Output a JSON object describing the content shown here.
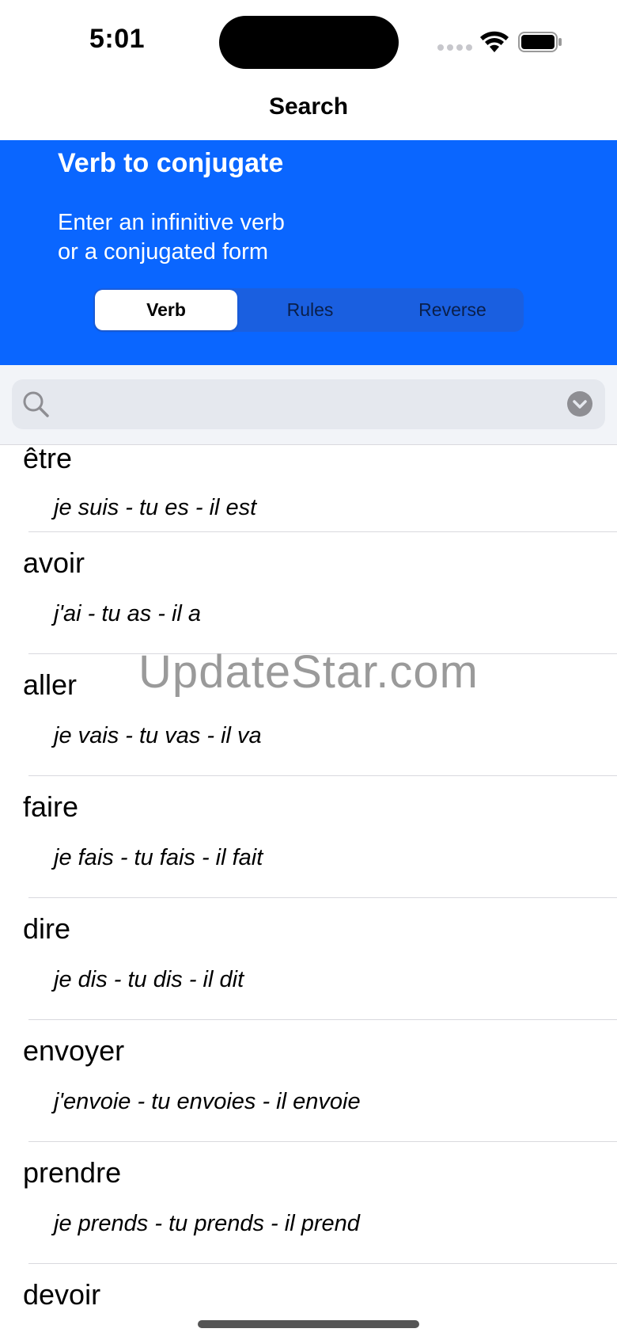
{
  "status_bar": {
    "time": "5:01"
  },
  "nav": {
    "title": "Search"
  },
  "header": {
    "title": "Verb to conjugate",
    "subtitle": "Enter an infinitive verb\nor a conjugated form",
    "segments": [
      {
        "label": "Verb",
        "selected": true
      },
      {
        "label": "Rules",
        "selected": false
      },
      {
        "label": "Reverse",
        "selected": false
      }
    ]
  },
  "search": {
    "value": "",
    "placeholder": ""
  },
  "verbs": [
    {
      "infinitive": "être",
      "conjugation": "je suis - tu es - il est"
    },
    {
      "infinitive": "avoir",
      "conjugation": "j'ai - tu as - il a"
    },
    {
      "infinitive": "aller",
      "conjugation": "je vais - tu vas - il va"
    },
    {
      "infinitive": "faire",
      "conjugation": "je fais - tu fais - il fait"
    },
    {
      "infinitive": "dire",
      "conjugation": "je dis - tu dis - il dit"
    },
    {
      "infinitive": "envoyer",
      "conjugation": "j'envoie - tu envoies - il envoie"
    },
    {
      "infinitive": "prendre",
      "conjugation": "je prends - tu prends - il prend"
    },
    {
      "infinitive": "devoir",
      "conjugation": ""
    }
  ],
  "watermark": "UpdateStar.com",
  "colors": {
    "accent": "#0a66ff",
    "search_bg": "#e5e8ee",
    "separator": "#d9d9de"
  },
  "icons": {
    "search": "magnifier-icon",
    "clear": "chevron-down-circle-icon",
    "wifi": "wifi-icon",
    "battery": "battery-icon",
    "signal": "cellular-signal-icon"
  }
}
